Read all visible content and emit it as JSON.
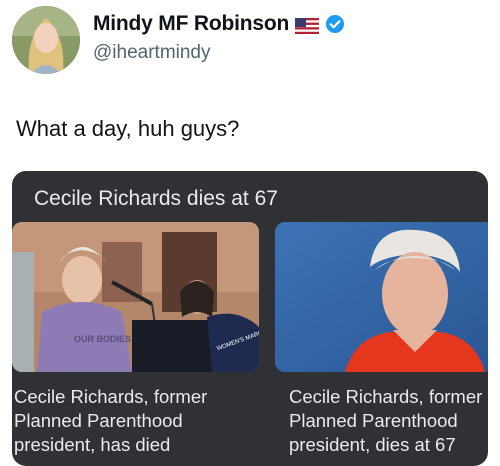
{
  "author": {
    "display_name": "Mindy MF Robinson",
    "handle": "@iheartmindy",
    "flag_icon": "us-flag-icon",
    "verified_icon": "verified-badge-icon",
    "verified_color": "#1d9bf0"
  },
  "tweet": {
    "text": "What a day, huh guys?"
  },
  "news_card": {
    "header": "Cecile Richards dies at 67",
    "articles": [
      {
        "headline": "Cecile Richards, former\nPlanned Parenthood\npresident, has died",
        "sign_text": "OUR BODIES",
        "banner_text": "WOMEN'S MARCH"
      },
      {
        "headline": "Cecile Richards, former\nPlanned Parenthood\npresident, dies at 67"
      }
    ]
  }
}
